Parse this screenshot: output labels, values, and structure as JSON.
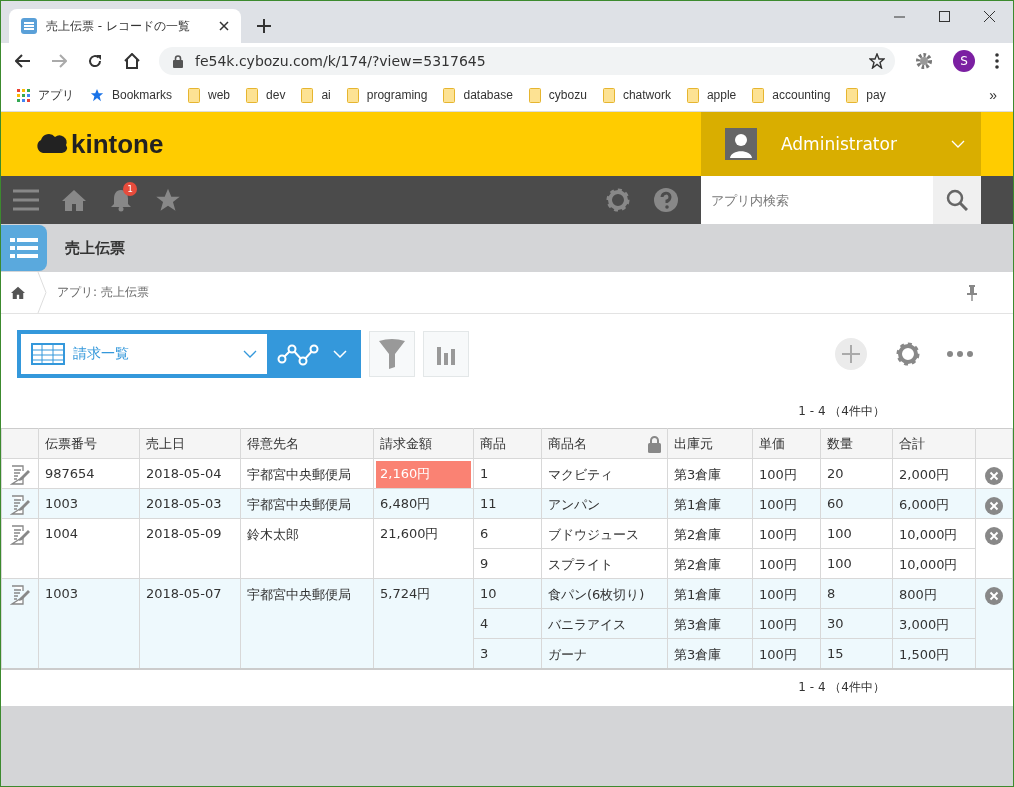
{
  "browser": {
    "tab_title": "売上伝票 - レコードの一覧",
    "url": "fe54k.cybozu.com/k/174/?view=5317645",
    "profile": "S",
    "bookmarks": [
      {
        "label": "アプリ",
        "kind": "apps"
      },
      {
        "label": "Bookmarks",
        "kind": "star"
      },
      {
        "label": "web",
        "kind": "folder"
      },
      {
        "label": "dev",
        "kind": "folder"
      },
      {
        "label": "ai",
        "kind": "folder"
      },
      {
        "label": "programing",
        "kind": "folder"
      },
      {
        "label": "database",
        "kind": "folder"
      },
      {
        "label": "cybozu",
        "kind": "folder"
      },
      {
        "label": "chatwork",
        "kind": "folder"
      },
      {
        "label": "apple",
        "kind": "folder"
      },
      {
        "label": "accounting",
        "kind": "folder"
      },
      {
        "label": "pay",
        "kind": "folder"
      }
    ],
    "more": "»"
  },
  "header": {
    "logo": "kintone",
    "user": "Administrator"
  },
  "nav": {
    "notifications": "1",
    "search_placeholder": "アプリ内検索"
  },
  "app": {
    "title": "売上伝票",
    "breadcrumb": "アプリ: 売上伝票"
  },
  "toolbar": {
    "view": "請求一覧"
  },
  "pagination_top": "1 - 4 （4件中）",
  "table": {
    "columns": [
      {
        "label": "伝票番号",
        "locked": false
      },
      {
        "label": "売上日",
        "locked": false
      },
      {
        "label": "得意先名",
        "locked": false
      },
      {
        "label": "請求金額",
        "locked": false
      },
      {
        "label": "商品",
        "locked": false
      },
      {
        "label": "商品名",
        "locked": true
      },
      {
        "label": "出庫元",
        "locked": false
      },
      {
        "label": "単価",
        "locked": false
      },
      {
        "label": "数量",
        "locked": false
      },
      {
        "label": "合計",
        "locked": false
      }
    ],
    "rows": [
      {
        "number": "987654",
        "date": "2018-05-04",
        "customer": "宇都宮中央郵便局",
        "amount": "2,160円",
        "highlighted": true,
        "items": [
          {
            "product": "1",
            "name": "マクビティ",
            "warehouse": "第3倉庫",
            "price": "100円",
            "qty": "20",
            "total": "2,000円"
          }
        ]
      },
      {
        "number": "1003",
        "date": "2018-05-03",
        "customer": "宇都宮中央郵便局",
        "amount": "6,480円",
        "highlighted": false,
        "items": [
          {
            "product": "11",
            "name": "アンパン",
            "warehouse": "第1倉庫",
            "price": "100円",
            "qty": "60",
            "total": "6,000円"
          }
        ]
      },
      {
        "number": "1004",
        "date": "2018-05-09",
        "customer": "鈴木太郎",
        "amount": "21,600円",
        "highlighted": false,
        "items": [
          {
            "product": "6",
            "name": "ブドウジュース",
            "warehouse": "第2倉庫",
            "price": "100円",
            "qty": "100",
            "total": "10,000円"
          },
          {
            "product": "9",
            "name": "スプライト",
            "warehouse": "第2倉庫",
            "price": "100円",
            "qty": "100",
            "total": "10,000円"
          }
        ]
      },
      {
        "number": "1003",
        "date": "2018-05-07",
        "customer": "宇都宮中央郵便局",
        "amount": "5,724円",
        "highlighted": false,
        "items": [
          {
            "product": "10",
            "name": "食パン(6枚切り)",
            "warehouse": "第1倉庫",
            "price": "100円",
            "qty": "8",
            "total": "800円"
          },
          {
            "product": "4",
            "name": "バニラアイス",
            "warehouse": "第3倉庫",
            "price": "100円",
            "qty": "30",
            "total": "3,000円"
          },
          {
            "product": "3",
            "name": "ガーナ",
            "warehouse": "第3倉庫",
            "price": "100円",
            "qty": "15",
            "total": "1,500円"
          }
        ]
      }
    ]
  },
  "pagination_bottom": "1 - 4 （4件中）"
}
